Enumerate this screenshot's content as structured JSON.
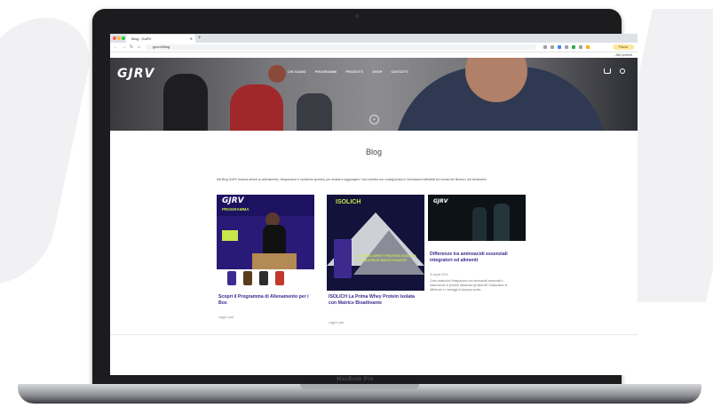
{
  "browser": {
    "tab_title": "Blog - GoRV",
    "url": "gorv.it/blog",
    "profile_label": "Pausa",
    "bookmarks_right": "Altri preferiti"
  },
  "site": {
    "logo": "GJRV",
    "menu": [
      "Chi siamo",
      "Programmi",
      "Prodotti",
      "Shop",
      "Contatti"
    ],
    "page_title": "Blog",
    "intro": "Nel Blog GoRV troverai articoli su allenamento, integrazione e nutrizione sportiva, per aiutarti a raggiungere i tuoi obiettivi con consigli pratici e informazioni affidabili sul mondo del fitness e del benessere."
  },
  "device": {
    "label": "MacBook Pro"
  },
  "posts": [
    {
      "title": "Scopri il Programma di Allenamento per i Box",
      "meta": "Leggi il post",
      "img_logo": "GJRV",
      "img_tag": "PROGRAMMA"
    },
    {
      "title": "ISOLICH La Prima Whey Protein Isolata con Matrice Bioattivante",
      "meta": "Leggi il post",
      "img_tag": "ISOLICH",
      "img_sub": "LA PRIMA WHEY PROTEIN ISOLATA CON MATRICE BIOATTIVANTE"
    },
    {
      "title": "Differenze tra aminoacidi essenziali integratori ed alimenti",
      "meta": "21 Aprile 2023",
      "img_logo": "GJRV",
      "excerpt": "Cosa cambia fra l'integrazione con aminoacidi essenziali e l'assunzione di proteine attraverso gli alimenti? Analizziamo le differenze e i vantaggi di ciascuna scelta."
    }
  ],
  "colors": {
    "accent_purple": "#3d2a8f",
    "card1_bg": "#2a1a78",
    "card2_bg": "#12123a",
    "card3_bg": "#0c1216",
    "lime": "#c8e84a"
  }
}
